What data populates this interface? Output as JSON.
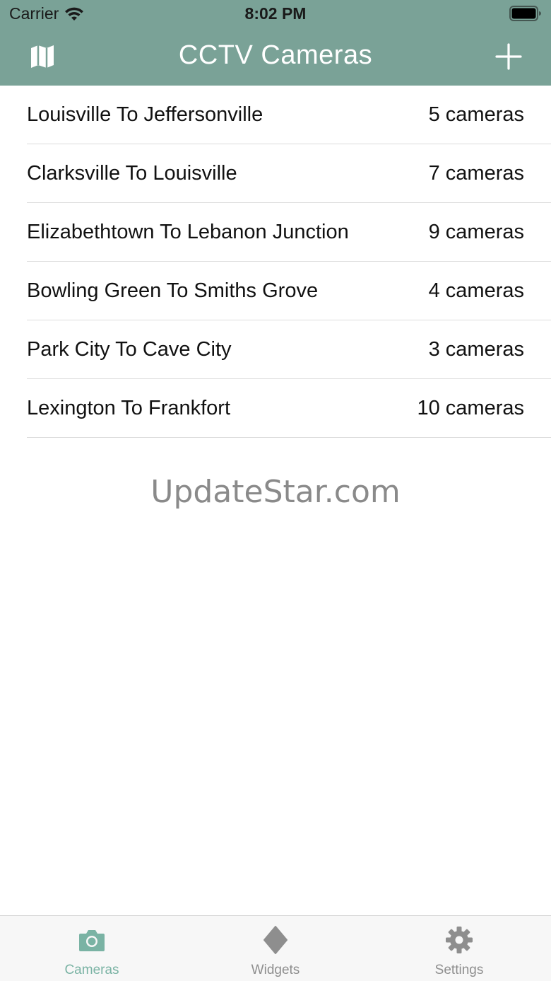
{
  "status_bar": {
    "carrier": "Carrier",
    "time": "8:02 PM"
  },
  "nav": {
    "title": "CCTV Cameras",
    "left_icon": "map-icon",
    "right_icon": "plus-icon"
  },
  "routes": [
    {
      "title": "Louisville To Jeffersonville",
      "count": "5 cameras"
    },
    {
      "title": "Clarksville To Louisville",
      "count": "7 cameras"
    },
    {
      "title": "Elizabethtown To Lebanon Junction",
      "count": "9 cameras"
    },
    {
      "title": "Bowling Green To Smiths Grove",
      "count": "4 cameras"
    },
    {
      "title": "Park City To Cave City",
      "count": "3 cameras"
    },
    {
      "title": "Lexington To Frankfort",
      "count": "10 cameras"
    }
  ],
  "watermark": "UpdateStar.com",
  "tabs": [
    {
      "label": "Cameras",
      "icon": "camera-icon",
      "active": true
    },
    {
      "label": "Widgets",
      "icon": "diamond-icon",
      "active": false
    },
    {
      "label": "Settings",
      "icon": "gear-icon",
      "active": false
    }
  ],
  "colors": {
    "nav_background": "#7aa297",
    "tab_active": "#7ab3a4",
    "tab_inactive": "#8e8e8e"
  }
}
